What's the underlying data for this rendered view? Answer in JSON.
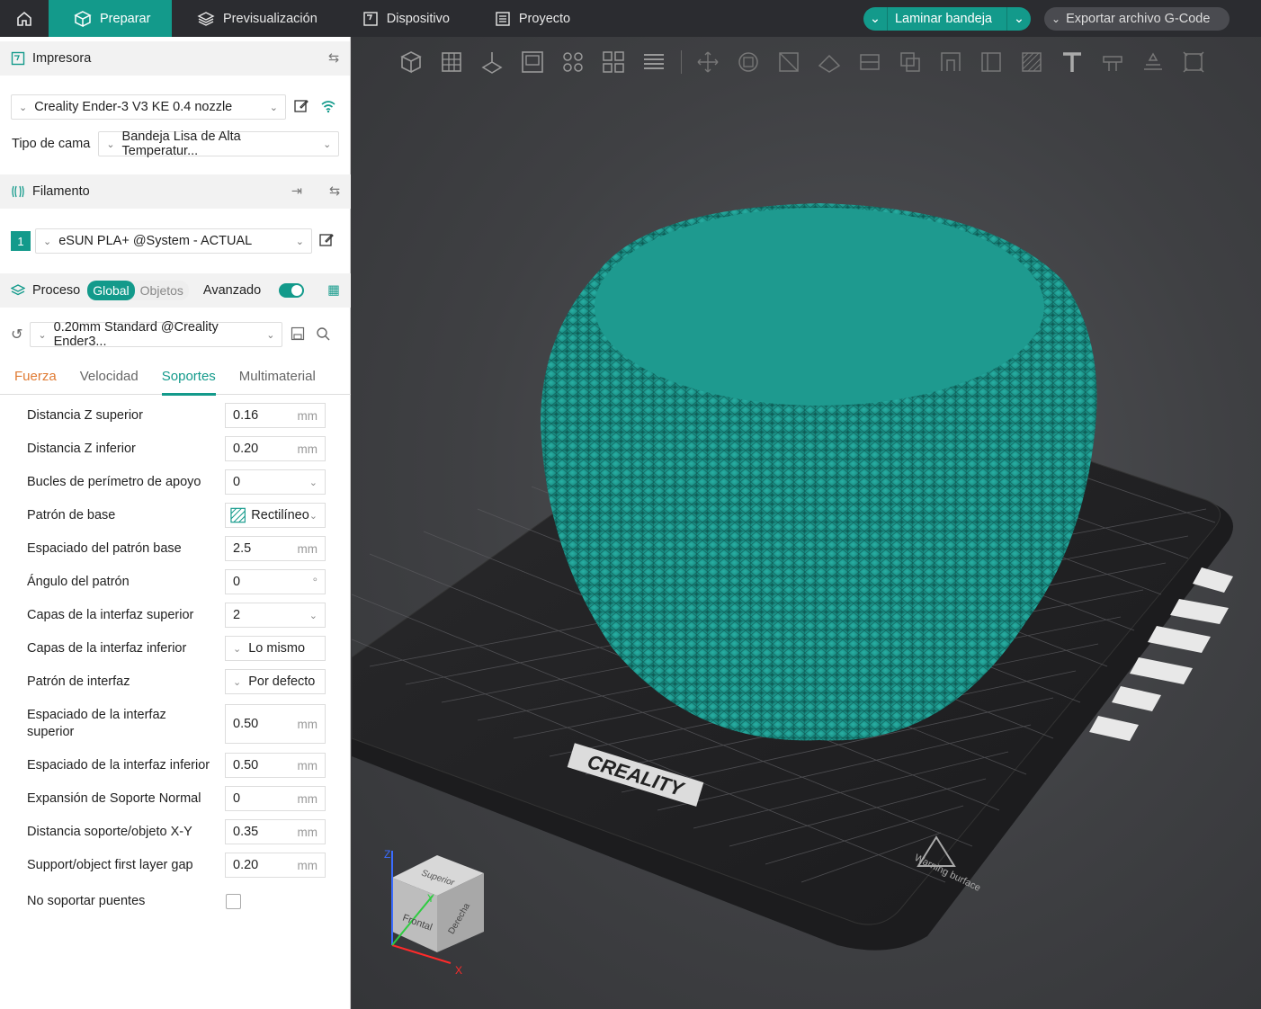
{
  "topbar": {
    "tabs": [
      {
        "label": "Preparar",
        "icon": "cube-icon"
      },
      {
        "label": "Previsualización",
        "icon": "layers-icon"
      },
      {
        "label": "Dispositivo",
        "icon": "device-icon"
      },
      {
        "label": "Proyecto",
        "icon": "project-icon"
      }
    ],
    "slice_label": "Laminar bandeja",
    "export_label": "Exportar archivo G-Code"
  },
  "printer": {
    "title": "Impresora",
    "name": "Creality Ender-3 V3 KE 0.4 nozzle",
    "bed_label": "Tipo de cama",
    "bed_value": "Bandeja Lisa de Alta Temperatur..."
  },
  "filament": {
    "title": "Filamento",
    "index": "1",
    "name": "eSUN PLA+ @System - ACTUAL",
    "color": "#139a8b"
  },
  "process": {
    "title": "Proceso",
    "seg_global": "Global",
    "seg_objects": "Objetos",
    "advanced_label": "Avanzado",
    "advanced_on": true,
    "preset": "0.20mm Standard @Creality Ender3..."
  },
  "tabs": [
    "Fuerza",
    "Velocidad",
    "Soportes",
    "Multimaterial"
  ],
  "params": [
    {
      "label": "Distancia Z superior",
      "value": "0.16",
      "unit": "mm",
      "kind": "unit"
    },
    {
      "label": "Distancia Z inferior",
      "value": "0.20",
      "unit": "mm",
      "kind": "unit"
    },
    {
      "label": "Bucles de perímetro de apoyo",
      "value": "0",
      "unit": "",
      "kind": "select"
    },
    {
      "label": "Patrón de base",
      "value": "Rectilíneo",
      "unit": "",
      "kind": "select"
    },
    {
      "label": "Espaciado del patrón base",
      "value": "2.5",
      "unit": "mm",
      "kind": "unit"
    },
    {
      "label": "Ángulo del patrón",
      "value": "0",
      "unit": "°",
      "kind": "unit"
    },
    {
      "label": "Capas de la interfaz superior",
      "value": "2",
      "unit": "",
      "kind": "select"
    },
    {
      "label": "Capas de la interfaz inferior",
      "value": "Lo mismo",
      "unit": "",
      "kind": "select-left"
    },
    {
      "label": "Patrón de interfaz",
      "value": "Por defecto",
      "unit": "",
      "kind": "select-left"
    },
    {
      "label": "Espaciado de la interfaz superior",
      "value": "0.50",
      "unit": "mm",
      "kind": "unit"
    },
    {
      "label": "Espaciado de la interfaz inferior",
      "value": "0.50",
      "unit": "mm",
      "kind": "unit"
    },
    {
      "label": "Expansión de Soporte Normal",
      "value": "0",
      "unit": "mm",
      "kind": "unit"
    },
    {
      "label": "Distancia soporte/objeto X-Y",
      "value": "0.35",
      "unit": "mm",
      "kind": "unit"
    },
    {
      "label": "Support/object first layer gap",
      "value": "0.20",
      "unit": "mm",
      "kind": "unit"
    },
    {
      "label": "No soportar puentes",
      "value": "",
      "unit": "",
      "kind": "checkbox"
    }
  ],
  "viewport": {
    "bed_brand": "CREALITY",
    "bed_warning": "Warning burface",
    "cube_faces": {
      "top": "Superior",
      "front": "Frontal",
      "right": "Derecha"
    },
    "axes": {
      "x": "X",
      "y": "Y",
      "z": "Z"
    },
    "model_color": "#1f9e94"
  }
}
